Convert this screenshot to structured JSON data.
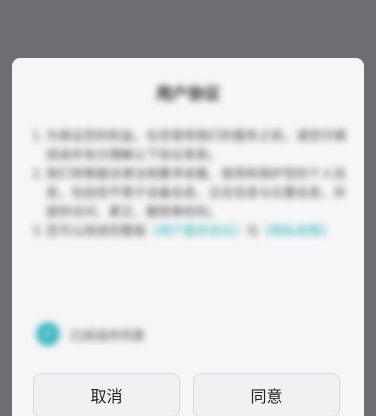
{
  "dialog": {
    "title": "用户协议",
    "paragraphs": [
      {
        "num": "1.",
        "text": "为保证您的权益，在您使用我们的服务之前，请您仔细阅读并充分理解以下协议条款。"
      },
      {
        "num": "2.",
        "text": "我们将根据法律法规要求收集、使用和保护您的个人信息，包括但不限于设备信息、日志信息与位置信息，并提供访问、更正、删除等权利。"
      },
      {
        "num": "3.",
        "text": "您可以阅读完整版",
        "link1": "《用户服务协议》",
        "mid": "与",
        "link2": "《隐私政策》"
      }
    ],
    "consent_label": "已阅读并同意",
    "cancel_label": "取消",
    "agree_label": "同意"
  },
  "icons": {
    "consent": "check-icon"
  },
  "colors": {
    "accent": "#41b8c2",
    "overlay": "#6e6e72",
    "dialog_bg": "#f6f6f8"
  }
}
